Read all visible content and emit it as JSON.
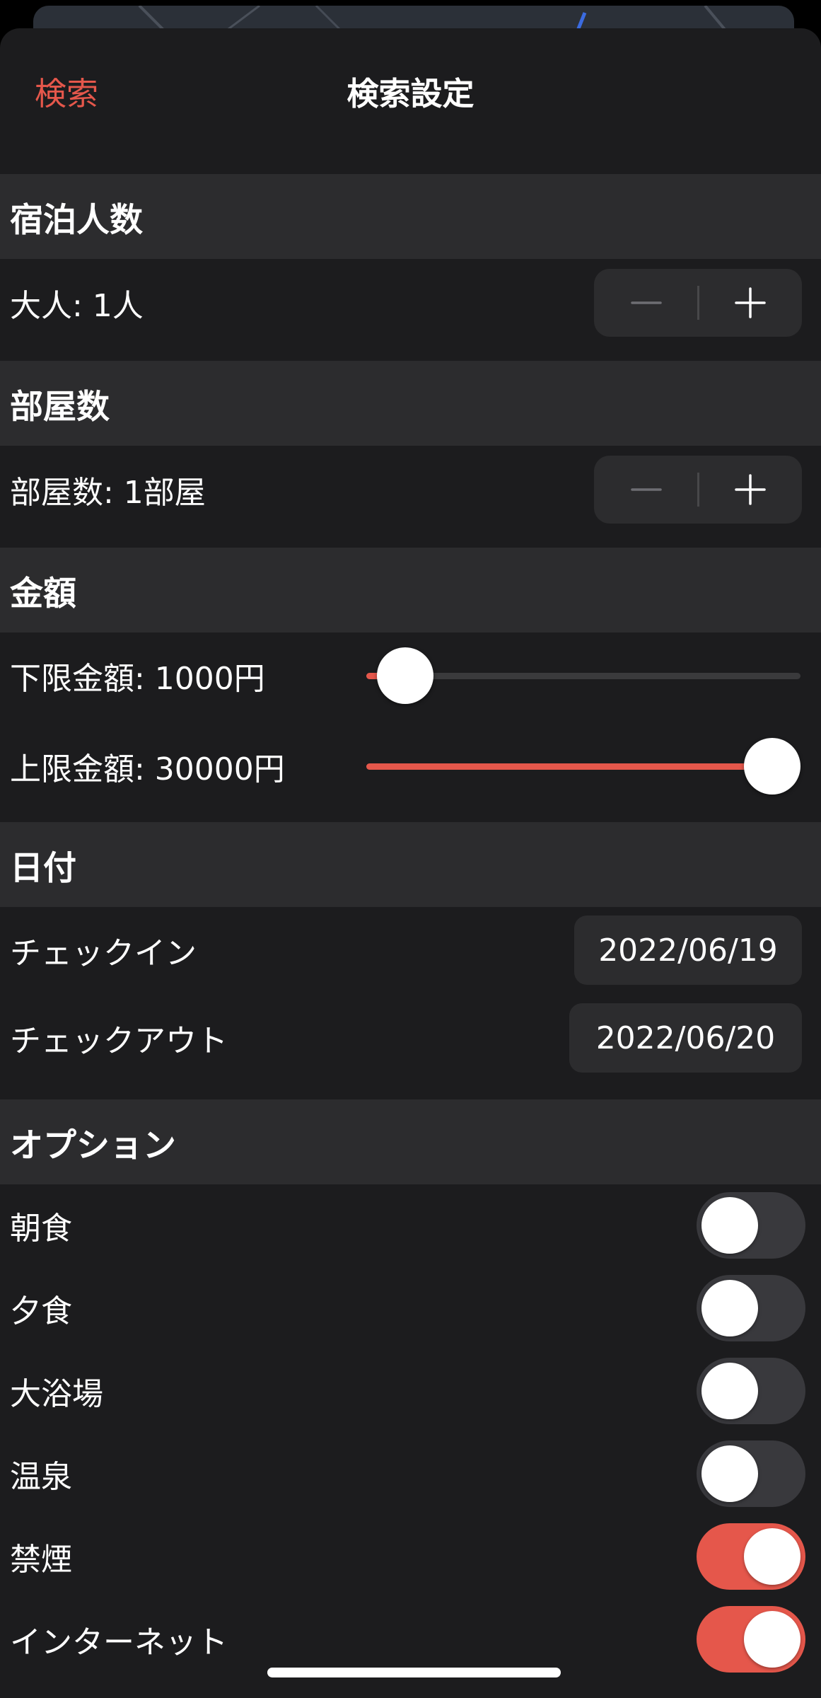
{
  "nav": {
    "back_label": "検索",
    "title": "検索設定"
  },
  "guests": {
    "header": "宿泊人数",
    "adults_label": "大人: 1人",
    "adults_value": 1
  },
  "rooms": {
    "header": "部屋数",
    "rooms_label": "部屋数: 1部屋",
    "rooms_value": 1
  },
  "price": {
    "header": "金額",
    "min_label": "下限金額: 1000円",
    "min_value": 1000,
    "max_label": "上限金額: 30000円",
    "max_value": 30000
  },
  "dates": {
    "header": "日付",
    "checkin_label": "チェックイン",
    "checkin_value": "2022/06/19",
    "checkout_label": "チェックアウト",
    "checkout_value": "2022/06/20"
  },
  "options": {
    "header": "オプション",
    "items": [
      {
        "label": "朝食",
        "enabled": false
      },
      {
        "label": "夕食",
        "enabled": false
      },
      {
        "label": "大浴場",
        "enabled": false
      },
      {
        "label": "温泉",
        "enabled": false
      },
      {
        "label": "禁煙",
        "enabled": true
      },
      {
        "label": "インターネット",
        "enabled": true
      }
    ]
  },
  "colors": {
    "accent": "#e5574b",
    "sheet_background": "#1c1c1e",
    "section_background": "#2c2c2e",
    "toggle_off": "#39393d"
  },
  "icons": {
    "decrement": "minus-icon",
    "increment": "plus-icon"
  }
}
